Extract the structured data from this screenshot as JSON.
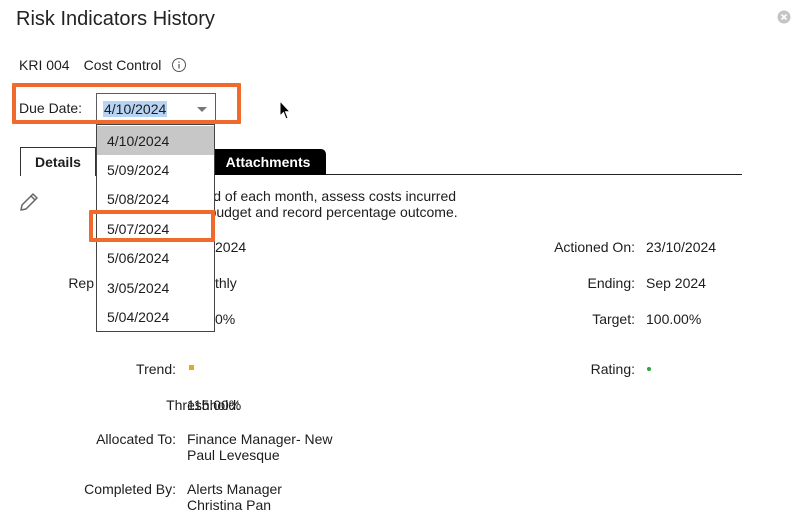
{
  "window": {
    "title": "Risk Indicators History"
  },
  "kri": {
    "code": "KRI 004",
    "name": "Cost Control"
  },
  "due_date": {
    "label": "Due Date:",
    "selected": "4/10/2024",
    "options": [
      "4/10/2024",
      "5/09/2024",
      "5/08/2024",
      "5/07/2024",
      "5/06/2024",
      "3/05/2024",
      "5/04/2024"
    ]
  },
  "tabs": {
    "details": "Details",
    "attachments": "Attachments"
  },
  "details": {
    "description_line1": "e end of each month, assess costs incurred",
    "description_line2": "nst budget and record percentage outcome.",
    "left_value_1": "2024",
    "reporting_label": "Rep",
    "reporting_value": "thly",
    "left_value_3": "0%",
    "trend_label": "Trend:",
    "threshold_label": "Threshhold:",
    "threshold_value": "115.00%",
    "allocated_label": "Allocated To:",
    "allocated_line1": "Finance Manager- New",
    "allocated_line2": "Paul Levesque",
    "completed_label": "Completed By:",
    "completed_line1": "Alerts Manager",
    "completed_line2": "Christina Pan",
    "actioned_label": "Actioned On:",
    "actioned_value": "23/10/2024",
    "ending_label": "Ending:",
    "ending_value": "Sep 2024",
    "target_label": "Target:",
    "target_value": "100.00%",
    "rating_label": "Rating:"
  },
  "colors": {
    "highlight": "#ef6a2c",
    "trend": "#e5a72a",
    "rating": "#2aa63b",
    "selection": "#b7d4f4"
  }
}
